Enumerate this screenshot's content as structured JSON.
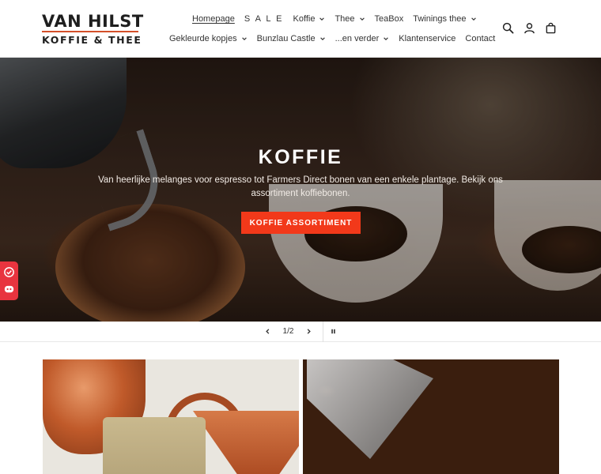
{
  "logo": {
    "top": "VAN HILST",
    "bottom": "KOFFIE & THEE"
  },
  "nav": {
    "row1": [
      {
        "label": "Homepage",
        "active": true,
        "dropdown": false
      },
      {
        "label": "S A L E",
        "active": false,
        "dropdown": false
      },
      {
        "label": "Koffie",
        "active": false,
        "dropdown": true
      },
      {
        "label": "Thee",
        "active": false,
        "dropdown": true
      },
      {
        "label": "TeaBox",
        "active": false,
        "dropdown": false
      },
      {
        "label": "Twinings thee",
        "active": false,
        "dropdown": true
      }
    ],
    "row2": [
      {
        "label": "Gekleurde kopjes",
        "dropdown": true
      },
      {
        "label": "Bunzlau Castle",
        "dropdown": true
      },
      {
        "label": "...en verder",
        "dropdown": true
      },
      {
        "label": "Klantenservice",
        "dropdown": false
      },
      {
        "label": "Contact",
        "dropdown": false
      }
    ]
  },
  "header_icons": [
    "search-icon",
    "account-icon",
    "cart-icon"
  ],
  "hero": {
    "title": "KOFFIE",
    "text": "Van heerlijke melanges voor espresso tot Farmers Direct bonen van een enkele plantage. Bekijk ons assortiment koffiebonen.",
    "button": "KOFFIE ASSORTIMENT"
  },
  "slider": {
    "counter": "1/2"
  },
  "colors": {
    "accent": "#f2391a",
    "logo_line": "#d4502a",
    "badge": "#e8343f"
  }
}
